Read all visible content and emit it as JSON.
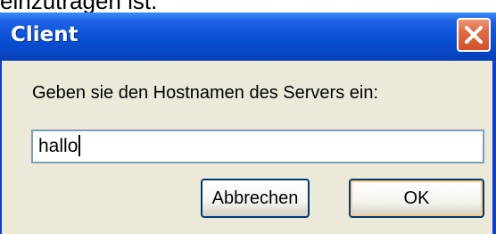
{
  "background_text": "einzutragen ist.",
  "window": {
    "title": "Client"
  },
  "dialog": {
    "prompt": "Geben sie den Hostnamen des Servers ein:",
    "hostname_value": "hallo",
    "cancel_label": "Abbrechen",
    "ok_label": "OK"
  },
  "icons": {
    "close": "close-icon"
  },
  "colors": {
    "titlebar": "#0a52d6",
    "window_bg": "#ece9d8",
    "close_button": "#d2512b",
    "input_border": "#7f9db9",
    "button_border": "#003c74"
  }
}
